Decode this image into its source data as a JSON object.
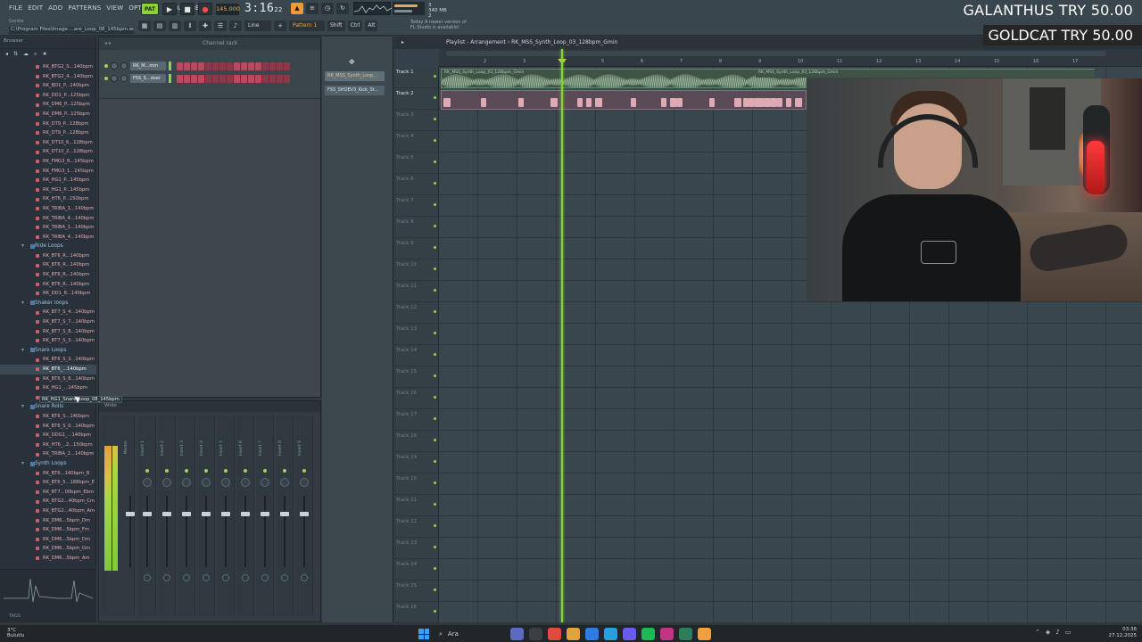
{
  "menu": [
    "FILE",
    "EDIT",
    "ADD",
    "PATTERNS",
    "VIEW",
    "OPTIONS",
    "TOOLS",
    "HELP"
  ],
  "hint": "Gentle",
  "song_path": "C:\\Program Files\\Image-...are_Loop_08_145bpm.wav",
  "transport": {
    "pat_label": "PAT",
    "tempo": "145.000",
    "time": "3:16",
    "time_small": "22"
  },
  "cpu_mem": {
    "line1": "3",
    "line2": "340 MB",
    "line3": "2"
  },
  "news": {
    "line1": "Today   A newer version of",
    "line2": "FL Studio is available!"
  },
  "pattern_select": "Pattern 1",
  "line_select": "Line",
  "keys": [
    "Shift",
    "Ctrl",
    "Alt"
  ],
  "browser": {
    "title": "Browser",
    "tree": [
      {
        "type": "item",
        "label": "RK_BTG2_S...140bpm"
      },
      {
        "type": "item",
        "label": "RK_BTG2_4...140bpm"
      },
      {
        "type": "item",
        "label": "RK_BD1_P...140bpm"
      },
      {
        "type": "item",
        "label": "RK_DD1_P...125bpm"
      },
      {
        "type": "item",
        "label": "RK_DM6_P...125bpm"
      },
      {
        "type": "item",
        "label": "RK_DM6_P...125bpm"
      },
      {
        "type": "item",
        "label": "RK_DT9_P...128bpm"
      },
      {
        "type": "item",
        "label": "RK_DT9_P...128bpm"
      },
      {
        "type": "item",
        "label": "RK_DT10_6...128bpm"
      },
      {
        "type": "item",
        "label": "RK_DT10_2...128bpm"
      },
      {
        "type": "item",
        "label": "RK_FMG3_8...145bpm"
      },
      {
        "type": "item",
        "label": "RK_FMG3_1...145bpm"
      },
      {
        "type": "item",
        "label": "RK_HG1_P...145bpm"
      },
      {
        "type": "item",
        "label": "RK_HG1_P...145bpm"
      },
      {
        "type": "item",
        "label": "RK_HT6_P...150bpm"
      },
      {
        "type": "item",
        "label": "RK_TRIBA_1...140bpm"
      },
      {
        "type": "item",
        "label": "RK_TRIBA_4...140bpm"
      },
      {
        "type": "item",
        "label": "RK_TRIBA_1...140bpm"
      },
      {
        "type": "item",
        "label": "RK_TRIBA_4...140bpm"
      },
      {
        "type": "folder",
        "label": "Ride Loops"
      },
      {
        "type": "item",
        "label": "RK_BT6_R...140bpm"
      },
      {
        "type": "item",
        "label": "RK_BT6_R...140bpm"
      },
      {
        "type": "item",
        "label": "RK_BT6_R...140bpm"
      },
      {
        "type": "item",
        "label": "RK_BT6_R...140bpm"
      },
      {
        "type": "item",
        "label": "RK_DD1_R...140bpm"
      },
      {
        "type": "folder",
        "label": "Shaker loops"
      },
      {
        "type": "item",
        "label": "RK_BT7_S_4...140bpm"
      },
      {
        "type": "item",
        "label": "RK_BT7_S_7...140bpm"
      },
      {
        "type": "item",
        "label": "RK_BT7_S_8...140bpm"
      },
      {
        "type": "item",
        "label": "RK_BT7_S_3...140bpm"
      },
      {
        "type": "folder",
        "label": "Snare Loops"
      },
      {
        "type": "item",
        "label": "RK_BT6_S_3...140bpm"
      },
      {
        "type": "item",
        "label": "RK_BT6_...140bpm",
        "sel": true
      },
      {
        "type": "item",
        "label": "RK_BT6_S_8...140bpm"
      },
      {
        "type": "item",
        "label": "RK_HG1_...145bpm"
      },
      {
        "type": "item",
        "label": ""
      },
      {
        "type": "folder",
        "label": "Snare Rolls"
      },
      {
        "type": "item",
        "label": "RK_BT6_S...140bpm"
      },
      {
        "type": "item",
        "label": "RK_BT6_S_0...140bpm"
      },
      {
        "type": "item",
        "label": "RK_DDG1_...140bpm"
      },
      {
        "type": "item",
        "label": "RK_HT6_..2...150bpm"
      },
      {
        "type": "item",
        "label": "RK_TRIBA_2...140bpm"
      },
      {
        "type": "folder",
        "label": "Synth Loops"
      },
      {
        "type": "item",
        "label": "RK_BT6...140bpm_B"
      },
      {
        "type": "item",
        "label": "RK_BT6_5...188bpm_E"
      },
      {
        "type": "item",
        "label": "RK_BT7...00bpm_Ebm"
      },
      {
        "type": "item",
        "label": "RK_BTG2...40bpm_Cm"
      },
      {
        "type": "item",
        "label": "RK_BTG2...40bpm_Am"
      },
      {
        "type": "item",
        "label": "RK_DM6...5bpm_Dm"
      },
      {
        "type": "item",
        "label": "RK_DM6...5bpm_Fm"
      },
      {
        "type": "item",
        "label": "RK_DM6...5bpm_Dm"
      },
      {
        "type": "item",
        "label": "RK_DM6...5bpm_Gm"
      },
      {
        "type": "item",
        "label": "RK_DM6...5bpm_Am"
      }
    ],
    "drag_label": "RK_HG1_Snare_Loop_08_145bpm",
    "foot_label": "TAGS"
  },
  "channel_rack": {
    "title": "Channel rack",
    "channels": [
      {
        "name": "RK_M...mm"
      },
      {
        "name": "FSS_S...doer"
      }
    ]
  },
  "mixer": {
    "title": "Wide",
    "master_label": "Master",
    "inserts": [
      "Insert 1",
      "Insert 2",
      "Insert 3",
      "Insert 4",
      "Insert 5",
      "Insert 6",
      "Insert 7",
      "Insert 8",
      "Insert 9"
    ]
  },
  "picker": [
    {
      "label": "RK_MSS_Synth_Loop...",
      "sel": true
    },
    {
      "label": "FSS_SHOEV3_Kick_St..."
    }
  ],
  "playlist": {
    "title_prefix": "Playlist - Arrangement",
    "title_pattern": "RK_MSS_Synth_Loop_03_128bpm_Gmin",
    "ruler_numbers": [
      "2",
      "3",
      "4",
      "5",
      "6",
      "7",
      "8",
      "9",
      "10",
      "11",
      "12",
      "13",
      "14",
      "15",
      "16",
      "17"
    ],
    "tracks": [
      "Track 1",
      "Track 2",
      "Track 3",
      "Track 4",
      "Track 5",
      "Track 6",
      "Track 7",
      "Track 8",
      "Track 9",
      "Track 10",
      "Track 11",
      "Track 12",
      "Track 13",
      "Track 14",
      "Track 15",
      "Track 16",
      "Track 17",
      "Track 18",
      "Track 19",
      "Track 20",
      "Track 21",
      "Track 22",
      "Track 23",
      "Track 24",
      "Track 25",
      "Track 26"
    ],
    "clip1_title": "RK_MSS_Synth_Loop_03_128bpm_Gmin",
    "clip2_title": "RK_MSS_Synth_Loop_03_128bpm_Gmin"
  },
  "overlay": {
    "line1": "GALANTHUS  TRY 50.00",
    "line2": "GOLDCAT  TRY 50.00"
  },
  "taskbar": {
    "weather_temp": "3°C",
    "weather_desc": "Bulutlu",
    "search": "Ara",
    "time": "03:36",
    "date": "27.12.2025"
  },
  "colors": {
    "accent_green": "#84d23a",
    "clip_pink": "#c76370",
    "playhead_tip": "#e9c440"
  }
}
